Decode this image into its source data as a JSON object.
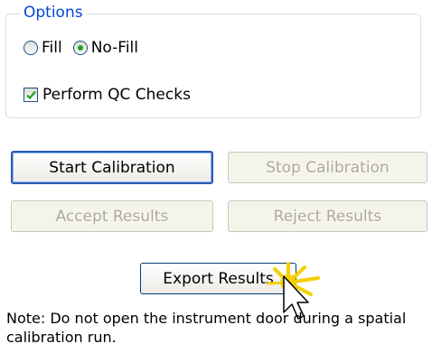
{
  "options": {
    "legend": "Options",
    "fill_label": "Fill",
    "nofill_label": "No-Fill",
    "selected": "No-Fill",
    "qc_label": "Perform QC Checks",
    "qc_checked": true
  },
  "buttons": {
    "start_calibration": "Start Calibration",
    "stop_calibration": "Stop Calibration",
    "accept_results": "Accept Results",
    "reject_results": "Reject Results",
    "export_results": "Export Results"
  },
  "note": "Note: Do not open the instrument door during a spatial calibration run.",
  "colors": {
    "legend": "#0046d5",
    "radio_dot": "#21a121",
    "checkmark": "#21a121",
    "disabled_text": "#aca899",
    "default_border": "#2a5bb0",
    "highlight": "#f6d000"
  },
  "icons": {
    "radio": "radio-button",
    "checkbox": "check-mark",
    "cursor": "arrow-cursor"
  }
}
